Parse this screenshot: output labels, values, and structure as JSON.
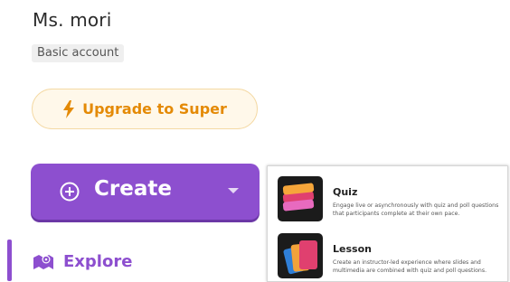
{
  "profile": {
    "name": "Ms. mori",
    "account_badge": "Basic account"
  },
  "upgrade": {
    "label": "Upgrade to Super",
    "icon": "lightning-bolt-icon",
    "color": "#e48a06"
  },
  "create": {
    "label": "Create",
    "icon": "plus-circle-icon",
    "color": "#8d4fcf"
  },
  "nav": {
    "explore_label": "Explore",
    "explore_icon": "map-pin-icon"
  },
  "create_menu": {
    "items": [
      {
        "title": "Quiz",
        "description": "Engage live or asynchronously with quiz and poll questions that participants complete at their own pace.",
        "icon": "quiz-stack-icon"
      },
      {
        "title": "Lesson",
        "description": "Create an instructor-led experience where slides and multimedia are combined with quiz and poll questions.",
        "icon": "lesson-cards-icon"
      }
    ]
  }
}
